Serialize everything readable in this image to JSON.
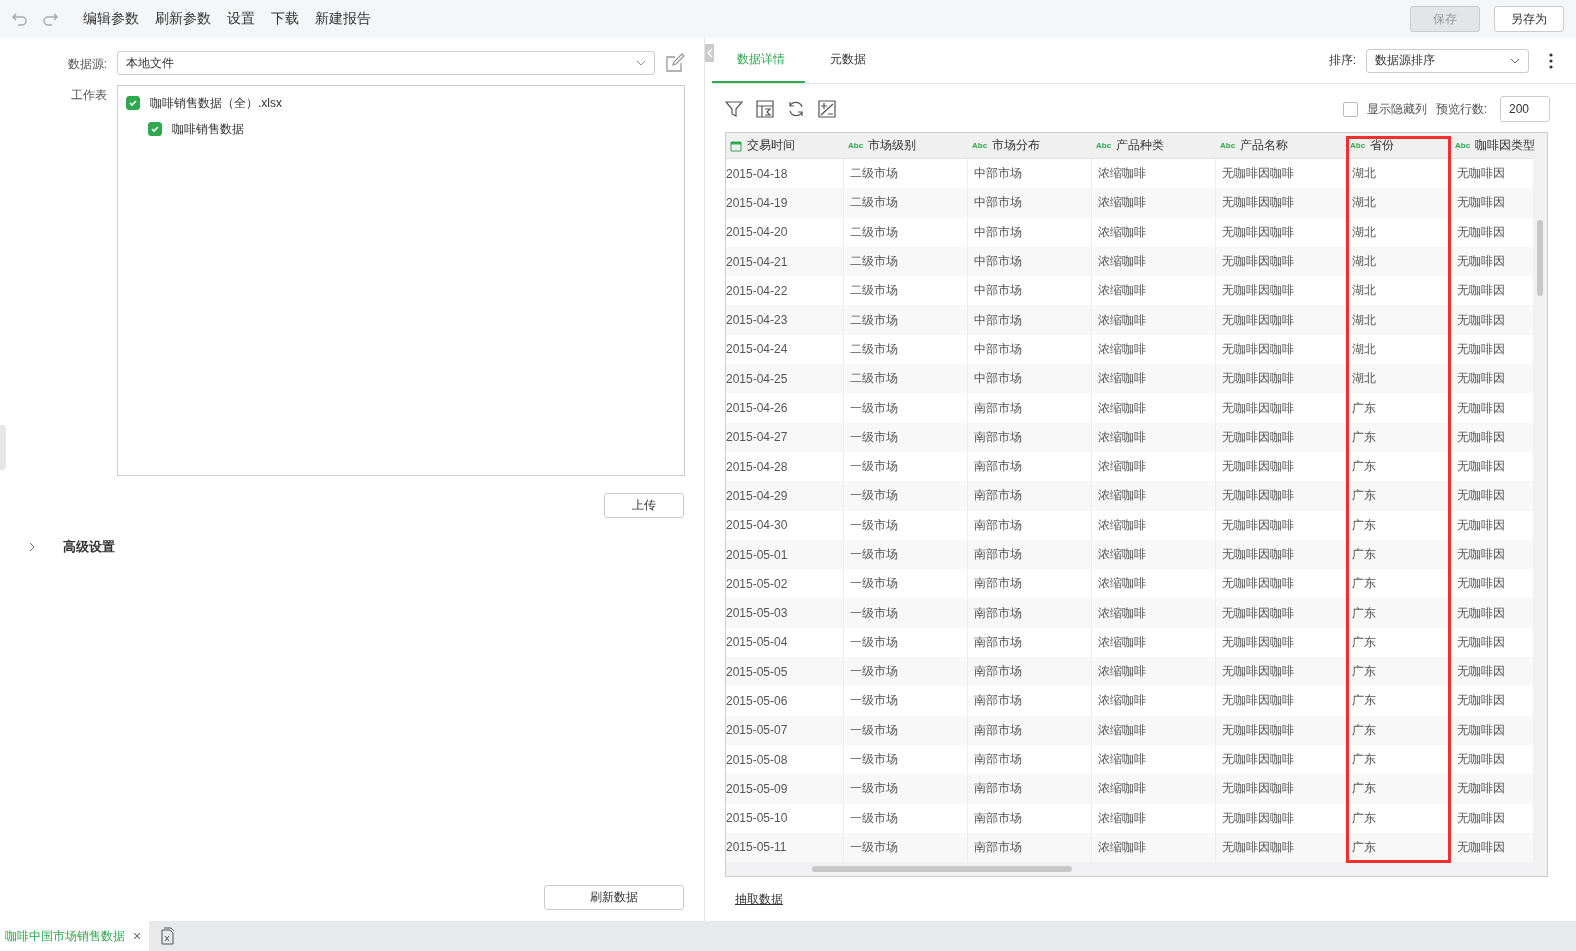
{
  "toolbar": {
    "menu": [
      "编辑参数",
      "刷新参数",
      "设置",
      "下载",
      "新建报告"
    ],
    "buttons": [
      {
        "label": "保存",
        "disabled": true
      },
      {
        "label": "另存为",
        "disabled": false
      }
    ]
  },
  "source": {
    "label": "数据源:",
    "value": "本地文件"
  },
  "worksheets": {
    "label": "工作表",
    "items": [
      {
        "label": "咖啡销售数据（全）.xlsx",
        "checked": true,
        "children": [
          {
            "label": "咖啡销售数据",
            "checked": true
          }
        ]
      }
    ]
  },
  "upload_button": "上传",
  "advanced": {
    "label": "高级设置",
    "expanded": false
  },
  "refresh_button": "刷新数据",
  "tabs": [
    {
      "label": "数据详情",
      "selected": true
    },
    {
      "label": "元数据",
      "selected": false
    }
  ],
  "sort": {
    "label": "排序:",
    "value": "数据源排序"
  },
  "show_hidden": {
    "label": "显示隐藏列",
    "checked": false
  },
  "preview_rows": {
    "label": "预览行数:",
    "value": "200"
  },
  "table": {
    "columns": [
      {
        "name": "交易时间",
        "kind": "date",
        "highlighted": false
      },
      {
        "name": "市场级别",
        "kind": "text",
        "badge": "Abc",
        "highlighted": false
      },
      {
        "name": "市场分布",
        "kind": "text",
        "badge": "Abc",
        "highlighted": false
      },
      {
        "name": "产品种类",
        "kind": "text",
        "badge": "Abc",
        "highlighted": false
      },
      {
        "name": "产品名称",
        "kind": "text",
        "badge": "Abc",
        "highlighted": false
      },
      {
        "name": "省份",
        "kind": "text",
        "badge": "Abc",
        "highlighted": true
      },
      {
        "name": "咖啡因类型",
        "kind": "text",
        "badge": "Abc",
        "highlighted": false
      }
    ],
    "rows": [
      [
        "2015-04-18",
        "二级市场",
        "中部市场",
        "浓缩咖啡",
        "无咖啡因咖啡",
        "湖北",
        "无咖啡因"
      ],
      [
        "2015-04-19",
        "二级市场",
        "中部市场",
        "浓缩咖啡",
        "无咖啡因咖啡",
        "湖北",
        "无咖啡因"
      ],
      [
        "2015-04-20",
        "二级市场",
        "中部市场",
        "浓缩咖啡",
        "无咖啡因咖啡",
        "湖北",
        "无咖啡因"
      ],
      [
        "2015-04-21",
        "二级市场",
        "中部市场",
        "浓缩咖啡",
        "无咖啡因咖啡",
        "湖北",
        "无咖啡因"
      ],
      [
        "2015-04-22",
        "二级市场",
        "中部市场",
        "浓缩咖啡",
        "无咖啡因咖啡",
        "湖北",
        "无咖啡因"
      ],
      [
        "2015-04-23",
        "二级市场",
        "中部市场",
        "浓缩咖啡",
        "无咖啡因咖啡",
        "湖北",
        "无咖啡因"
      ],
      [
        "2015-04-24",
        "二级市场",
        "中部市场",
        "浓缩咖啡",
        "无咖啡因咖啡",
        "湖北",
        "无咖啡因"
      ],
      [
        "2015-04-25",
        "二级市场",
        "中部市场",
        "浓缩咖啡",
        "无咖啡因咖啡",
        "湖北",
        "无咖啡因"
      ],
      [
        "2015-04-26",
        "一级市场",
        "南部市场",
        "浓缩咖啡",
        "无咖啡因咖啡",
        "广东",
        "无咖啡因"
      ],
      [
        "2015-04-27",
        "一级市场",
        "南部市场",
        "浓缩咖啡",
        "无咖啡因咖啡",
        "广东",
        "无咖啡因"
      ],
      [
        "2015-04-28",
        "一级市场",
        "南部市场",
        "浓缩咖啡",
        "无咖啡因咖啡",
        "广东",
        "无咖啡因"
      ],
      [
        "2015-04-29",
        "一级市场",
        "南部市场",
        "浓缩咖啡",
        "无咖啡因咖啡",
        "广东",
        "无咖啡因"
      ],
      [
        "2015-04-30",
        "一级市场",
        "南部市场",
        "浓缩咖啡",
        "无咖啡因咖啡",
        "广东",
        "无咖啡因"
      ],
      [
        "2015-05-01",
        "一级市场",
        "南部市场",
        "浓缩咖啡",
        "无咖啡因咖啡",
        "广东",
        "无咖啡因"
      ],
      [
        "2015-05-02",
        "一级市场",
        "南部市场",
        "浓缩咖啡",
        "无咖啡因咖啡",
        "广东",
        "无咖啡因"
      ],
      [
        "2015-05-03",
        "一级市场",
        "南部市场",
        "浓缩咖啡",
        "无咖啡因咖啡",
        "广东",
        "无咖啡因"
      ],
      [
        "2015-05-04",
        "一级市场",
        "南部市场",
        "浓缩咖啡",
        "无咖啡因咖啡",
        "广东",
        "无咖啡因"
      ],
      [
        "2015-05-05",
        "一级市场",
        "南部市场",
        "浓缩咖啡",
        "无咖啡因咖啡",
        "广东",
        "无咖啡因"
      ],
      [
        "2015-05-06",
        "一级市场",
        "南部市场",
        "浓缩咖啡",
        "无咖啡因咖啡",
        "广东",
        "无咖啡因"
      ],
      [
        "2015-05-07",
        "一级市场",
        "南部市场",
        "浓缩咖啡",
        "无咖啡因咖啡",
        "广东",
        "无咖啡因"
      ],
      [
        "2015-05-08",
        "一级市场",
        "南部市场",
        "浓缩咖啡",
        "无咖啡因咖啡",
        "广东",
        "无咖啡因"
      ],
      [
        "2015-05-09",
        "一级市场",
        "南部市场",
        "浓缩咖啡",
        "无咖啡因咖啡",
        "广东",
        "无咖啡因"
      ],
      [
        "2015-05-10",
        "一级市场",
        "南部市场",
        "浓缩咖啡",
        "无咖啡因咖啡",
        "广东",
        "无咖啡因"
      ],
      [
        "2015-05-11",
        "一级市场",
        "南部市场",
        "浓缩咖啡",
        "无咖啡因咖啡",
        "广东",
        "无咖啡因"
      ]
    ]
  },
  "extract_link": "抽取数据",
  "bottom_tabs": [
    {
      "label": "咖啡中国市场销售数据",
      "selected": true,
      "close": "×"
    }
  ]
}
